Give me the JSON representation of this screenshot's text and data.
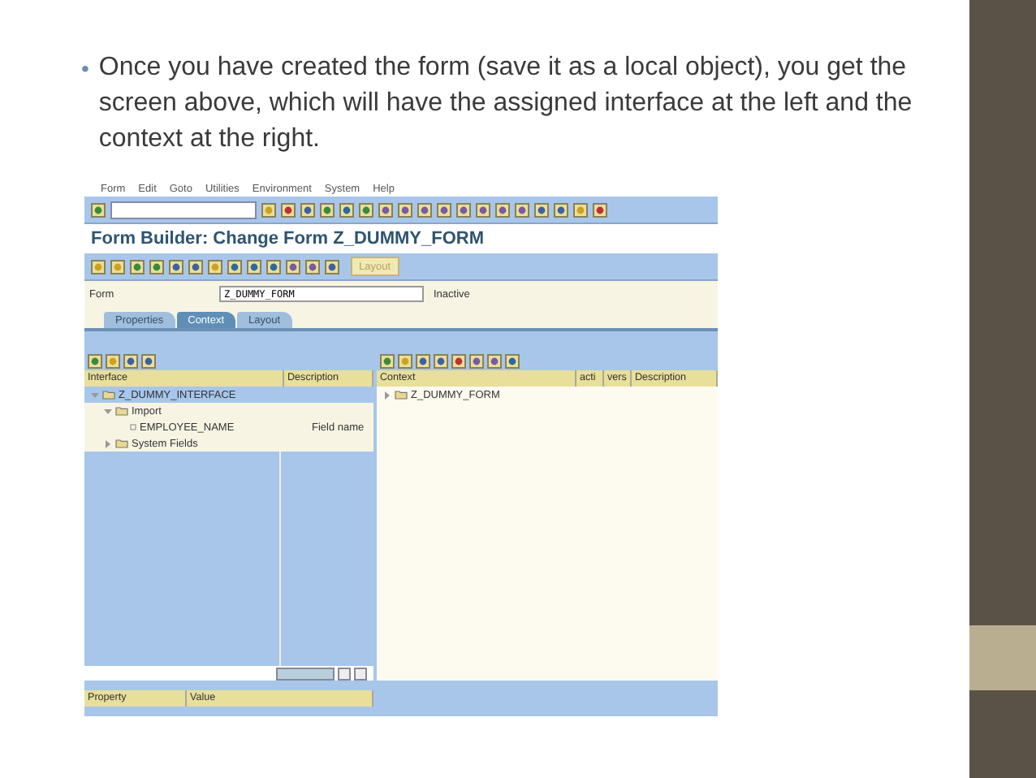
{
  "bullet": {
    "marker": "•",
    "text": "Once you have created the form (save it as a local object), you get the screen above, which will have the assigned interface at the left and the context at the right."
  },
  "sap": {
    "menu": [
      "Form",
      "Edit",
      "Goto",
      "Utilities",
      "Environment",
      "System",
      "Help"
    ],
    "title": "Form Builder: Change Form Z_DUMMY_FORM",
    "layout_button": "Layout",
    "form": {
      "label": "Form",
      "value": "Z_DUMMY_FORM",
      "status": "Inactive"
    },
    "tabs": [
      {
        "label": "Properties",
        "selected": false
      },
      {
        "label": "Context",
        "selected": true
      },
      {
        "label": "Layout",
        "selected": false
      }
    ],
    "interface": {
      "columns": [
        "Interface",
        "Description"
      ],
      "tree": [
        {
          "name": "Z_DUMMY_INTERFACE",
          "kind": "folder",
          "expanded": true,
          "selected": true,
          "children": [
            {
              "name": "Import",
              "kind": "folder",
              "expanded": true,
              "selected": false,
              "children": [
                {
                  "name": "EMPLOYEE_NAME",
                  "kind": "field",
                  "description": "Field name",
                  "selected": false
                }
              ]
            },
            {
              "name": "System Fields",
              "kind": "folder",
              "expanded": false,
              "selected": false
            }
          ]
        }
      ]
    },
    "context": {
      "columns": [
        "Context",
        "acti",
        "vers",
        "Description"
      ],
      "tree": [
        {
          "name": "Z_DUMMY_FORM",
          "kind": "folder",
          "expanded": false,
          "selected": false
        }
      ]
    },
    "properties": {
      "columns": [
        "Property",
        "Value"
      ]
    }
  }
}
